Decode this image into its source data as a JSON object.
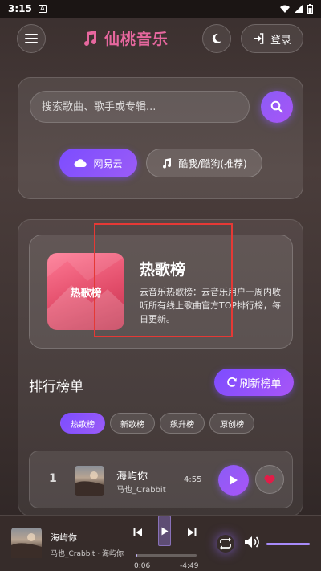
{
  "status_bar": {
    "time": "3:15",
    "notification_icon": "A"
  },
  "header": {
    "app_title": "仙桃音乐",
    "login_label": "登录"
  },
  "search": {
    "placeholder": "搜索歌曲、歌手或专辑...",
    "sources": [
      {
        "label": "网易云",
        "active": true
      },
      {
        "label": "酷我/酷狗(推荐)",
        "active": false
      }
    ]
  },
  "featured_chart": {
    "cover_text": "热歌榜",
    "title": "热歌榜",
    "description": "云音乐热歌榜：云音乐用户一周内收听所有线上歌曲官方TOP排行榜，每日更新。",
    "cover_color": "#e24d6a"
  },
  "rankings": {
    "heading": "排行榜单",
    "refresh_label": "刷新榜单",
    "tabs": [
      "热歌榜",
      "新歌榜",
      "飙升榜",
      "原创榜"
    ],
    "active_tab": 0,
    "songs": [
      {
        "index": "1",
        "name": "海屿你",
        "artist": "马也_Crabbit",
        "duration": "4:55"
      }
    ]
  },
  "player": {
    "song_name": "海屿你",
    "artist_line": "马也_Crabbit · 海屿你",
    "current_time": "0:06",
    "remaining_time": "-4:49",
    "progress": 0.02,
    "volume": 1.0
  },
  "colors": {
    "accent": "#8b5cf6",
    "brand": "#e6679e",
    "favorite": "#e11d48"
  },
  "icons": [
    "menu-icon",
    "music-note-icon",
    "moon-icon",
    "login-icon",
    "search-icon",
    "cloud-icon",
    "music-icon",
    "refresh-icon",
    "play-icon",
    "heart-icon",
    "prev-icon",
    "next-icon",
    "repeat-icon",
    "volume-icon"
  ]
}
